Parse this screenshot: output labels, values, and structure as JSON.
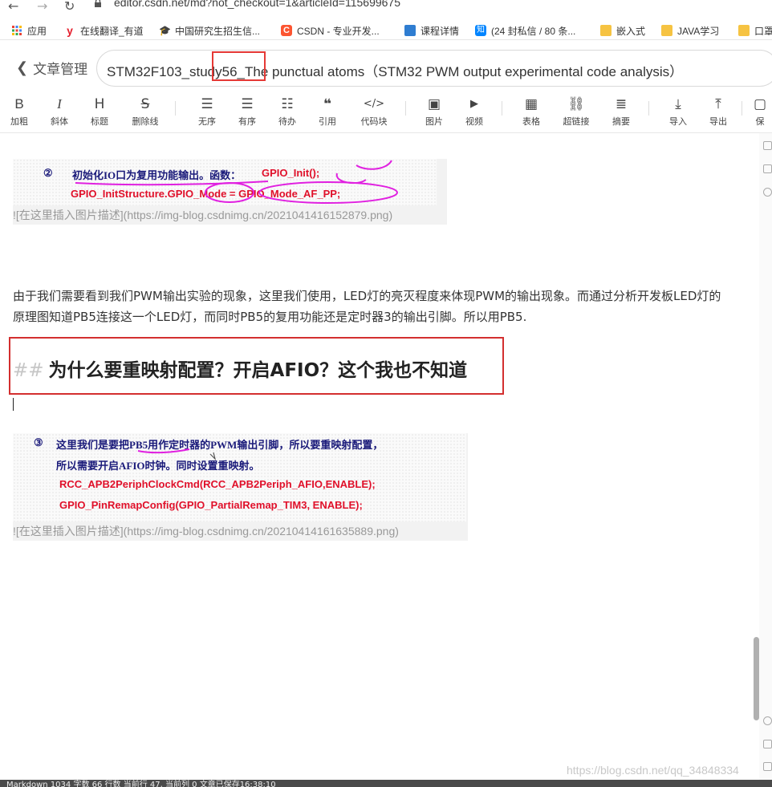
{
  "browser": {
    "url": "editor.csdn.net/md?not_checkout=1&articleId=115699675",
    "bookmarks": [
      {
        "label": "应用",
        "icon": "apps-grid-icon",
        "color": "#4285f4"
      },
      {
        "label": "在线翻译_有道",
        "icon": "youdao-icon",
        "color": "#e5202e"
      },
      {
        "label": "中国研究生招生信...",
        "icon": "graduation-cap-icon",
        "color": "#222222"
      },
      {
        "label": "CSDN - 专业开发...",
        "icon": "csdn-icon",
        "color": "#fc5531"
      },
      {
        "label": "课程详情",
        "icon": "course-icon",
        "color": "#2f7dd1"
      },
      {
        "label": "(24 封私信 / 80 条...",
        "icon": "zhihu-icon",
        "color": "#0084ff"
      },
      {
        "label": "嵌入式",
        "icon": "folder-icon",
        "color": "#f6c342"
      },
      {
        "label": "JAVA学习",
        "icon": "folder-icon",
        "color": "#f6c342"
      },
      {
        "label": "口罩",
        "icon": "folder-icon",
        "color": "#f6c342"
      }
    ]
  },
  "header": {
    "back_label": "文章管理",
    "title": "STM32F103_study56_The punctual atoms（STM32  PWM output experimental code analysis）"
  },
  "toolbar": {
    "items": [
      {
        "icon": "bold-icon",
        "glyph": "B",
        "label": "加粗"
      },
      {
        "icon": "italic-icon",
        "glyph": "I",
        "label": "斜体"
      },
      {
        "icon": "heading-icon",
        "glyph": "H",
        "label": "标题"
      },
      {
        "icon": "strikethrough-icon",
        "glyph": "S",
        "label": "删除线"
      },
      {
        "icon": "unordered-list-icon",
        "glyph": "☰",
        "label": "无序"
      },
      {
        "icon": "ordered-list-icon",
        "glyph": "☰",
        "label": "有序"
      },
      {
        "icon": "todo-list-icon",
        "glyph": "☷",
        "label": "待办"
      },
      {
        "icon": "quote-icon",
        "glyph": "❝",
        "label": "引用"
      },
      {
        "icon": "code-block-icon",
        "glyph": "</>",
        "label": "代码块"
      },
      {
        "icon": "image-icon",
        "glyph": "▣",
        "label": "图片"
      },
      {
        "icon": "video-icon",
        "glyph": "▶",
        "label": "视频"
      },
      {
        "icon": "table-icon",
        "glyph": "▦",
        "label": "表格"
      },
      {
        "icon": "link-icon",
        "glyph": "⛓",
        "label": "超链接"
      },
      {
        "icon": "summary-icon",
        "glyph": "≣",
        "label": "摘要"
      },
      {
        "icon": "import-icon",
        "glyph": "⤓",
        "label": "导入"
      },
      {
        "icon": "export-icon",
        "glyph": "⤒",
        "label": "导出"
      },
      {
        "icon": "save-icon",
        "glyph": "▢",
        "label": "保"
      }
    ]
  },
  "content": {
    "image1": {
      "lines": [
        "②",
        "初始化IO口为复用功能输出。函数：",
        "GPIO_Init();",
        "GPIO_InitStructure.GPIO_Mode = GPIO_Mode_AF_PP;"
      ],
      "markdown": "![在这里插入图片描述](https://img-blog.csdnimg.cn/2021041416152879.png)"
    },
    "paragraph": "由于我们需要看到我们PWM输出实验的现象，这里我们使用，LED灯的亮灭程度来体现PWM的输出现象。而通过分析开发板LED灯的原理图知道PB5连接这一个LED灯，而同时PB5的复用功能还是定时器3的输出引脚。所以用PB5.",
    "heading_marker": "##",
    "heading": "为什么要重映射配置？开启AFIO？这个我也不知道",
    "image2": {
      "lines": [
        "③",
        "这里我们是要把PB5用作定时器的PWM输出引脚，所以要重映射配置，",
        "所以需要开启AFIO时钟。同时设置重映射。",
        "RCC_APB2PeriphClockCmd(RCC_APB2Periph_AFIO,ENABLE);",
        "GPIO_PinRemapConfig(GPIO_PartialRemap_TIM3, ENABLE);"
      ],
      "markdown": "![在这里插入图片描述](https://img-blog.csdnimg.cn/20210414161635889.png)"
    }
  },
  "status": {
    "text": "Markdown  1034 字数  66 行数  当前行 47, 当前列 0  文章已保存16:38:10",
    "watermark": "https://blog.csdn.net/qq_34848334"
  }
}
